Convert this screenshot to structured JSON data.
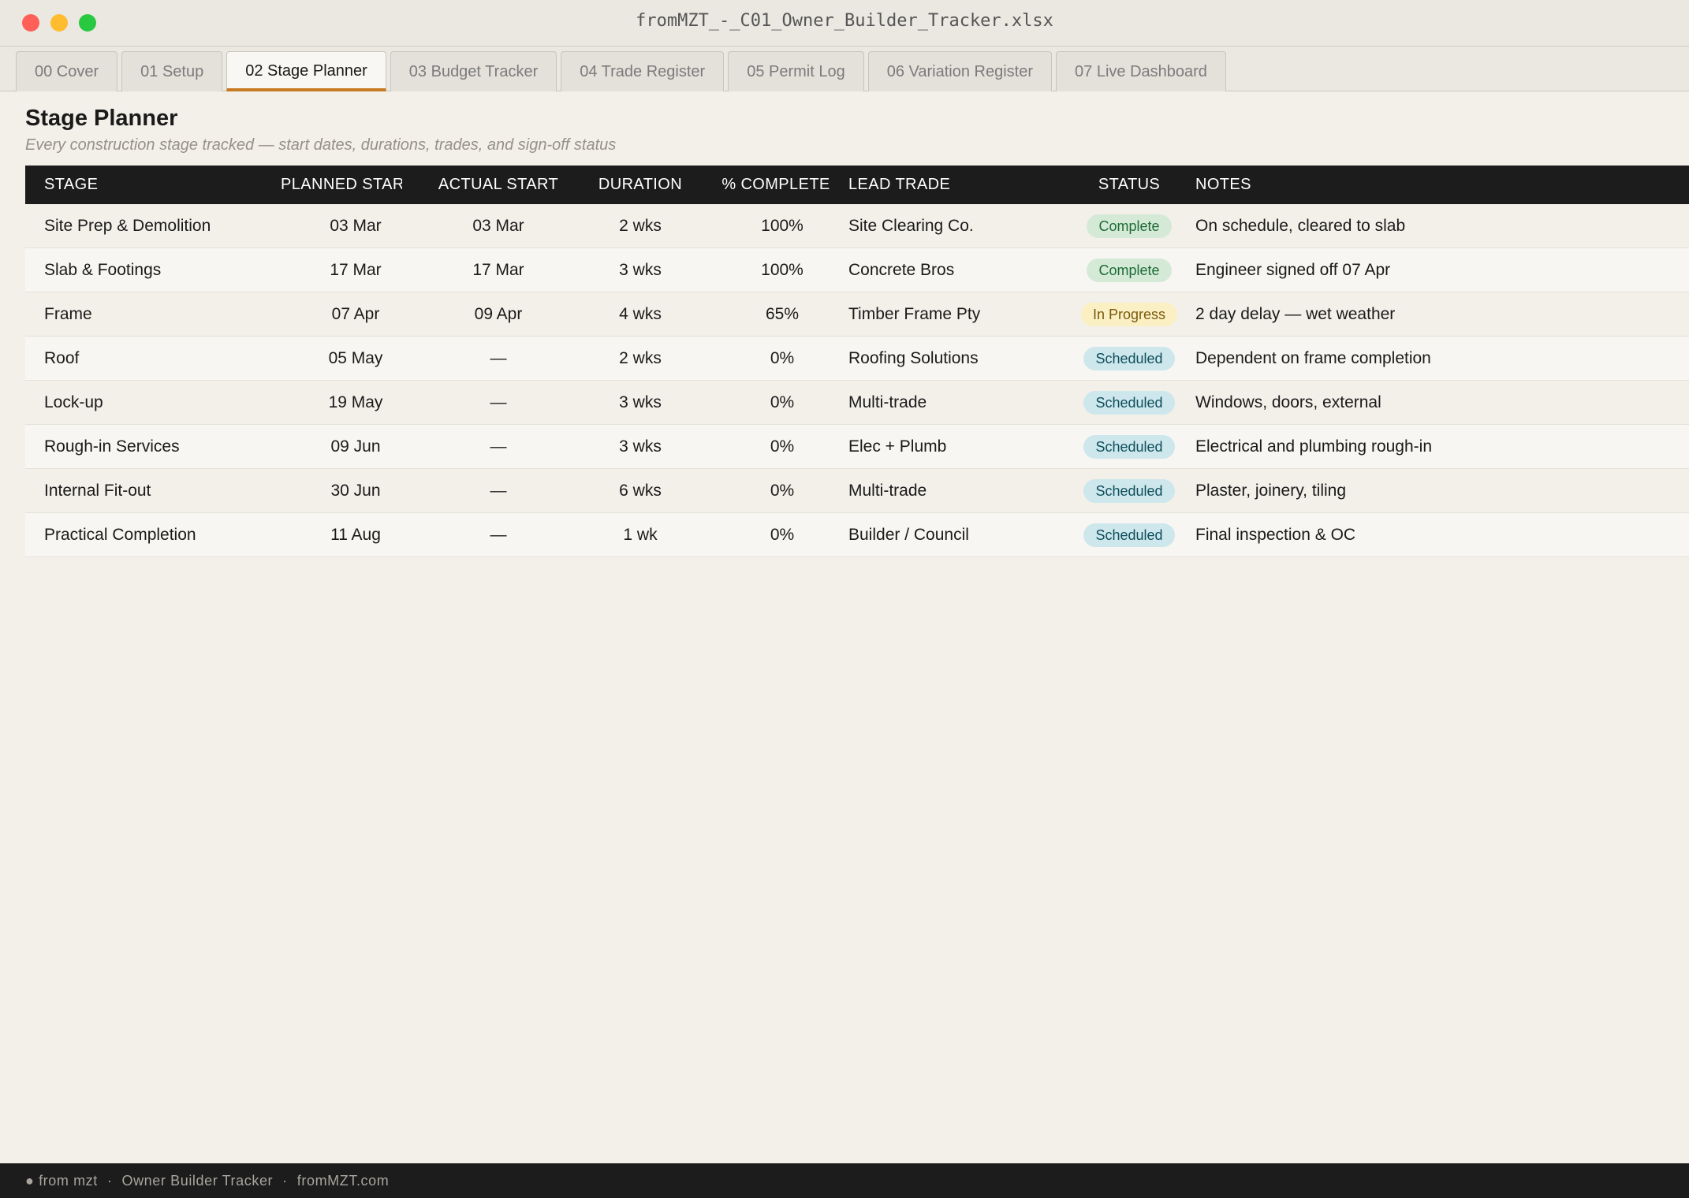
{
  "window": {
    "title": "fromMZT_-_C01_Owner_Builder_Tracker.xlsx"
  },
  "tabs": [
    {
      "label": "00 Cover",
      "active": false
    },
    {
      "label": "01 Setup",
      "active": false
    },
    {
      "label": "02 Stage Planner",
      "active": true
    },
    {
      "label": "03 Budget Tracker",
      "active": false
    },
    {
      "label": "04 Trade Register",
      "active": false
    },
    {
      "label": "05 Permit Log",
      "active": false
    },
    {
      "label": "06 Variation Register",
      "active": false
    },
    {
      "label": "07 Live Dashboard",
      "active": false
    }
  ],
  "page": {
    "title": "Stage Planner",
    "subtitle": "Every construction stage tracked — start dates, durations, trades, and sign-off status"
  },
  "table": {
    "headers": {
      "stage": "STAGE",
      "planned_start": "PLANNED START",
      "actual_start": "ACTUAL START",
      "duration": "DURATION",
      "pct_complete": "% COMPLETE",
      "lead_trade": "LEAD TRADE",
      "status": "STATUS",
      "notes": "NOTES"
    },
    "rows": [
      {
        "stage": "Site Prep & Demolition",
        "planned_start": "03 Mar",
        "actual_start": "03 Mar",
        "duration": "2 wks",
        "pct_complete": "100%",
        "lead_trade": "Site Clearing Co.",
        "status": "Complete",
        "status_kind": "complete",
        "notes": "On schedule, cleared to slab"
      },
      {
        "stage": "Slab & Footings",
        "planned_start": "17 Mar",
        "actual_start": "17 Mar",
        "duration": "3 wks",
        "pct_complete": "100%",
        "lead_trade": "Concrete Bros",
        "status": "Complete",
        "status_kind": "complete",
        "notes": "Engineer signed off 07 Apr"
      },
      {
        "stage": "Frame",
        "planned_start": "07 Apr",
        "actual_start": "09 Apr",
        "duration": "4 wks",
        "pct_complete": "65%",
        "lead_trade": "Timber Frame Pty",
        "status": "In Progress",
        "status_kind": "progress",
        "notes": "2 day delay — wet weather"
      },
      {
        "stage": "Roof",
        "planned_start": "05 May",
        "actual_start": "—",
        "duration": "2 wks",
        "pct_complete": "0%",
        "lead_trade": "Roofing Solutions",
        "status": "Scheduled",
        "status_kind": "scheduled",
        "notes": "Dependent on frame completion"
      },
      {
        "stage": "Lock-up",
        "planned_start": "19 May",
        "actual_start": "—",
        "duration": "3 wks",
        "pct_complete": "0%",
        "lead_trade": "Multi-trade",
        "status": "Scheduled",
        "status_kind": "scheduled",
        "notes": "Windows, doors, external"
      },
      {
        "stage": "Rough-in Services",
        "planned_start": "09 Jun",
        "actual_start": "—",
        "duration": "3 wks",
        "pct_complete": "0%",
        "lead_trade": "Elec + Plumb",
        "status": "Scheduled",
        "status_kind": "scheduled",
        "notes": "Electrical and plumbing rough-in"
      },
      {
        "stage": "Internal Fit-out",
        "planned_start": "30 Jun",
        "actual_start": "—",
        "duration": "6 wks",
        "pct_complete": "0%",
        "lead_trade": "Multi-trade",
        "status": "Scheduled",
        "status_kind": "scheduled",
        "notes": "Plaster, joinery, tiling"
      },
      {
        "stage": "Practical Completion",
        "planned_start": "11 Aug",
        "actual_start": "—",
        "duration": "1 wk",
        "pct_complete": "0%",
        "lead_trade": "Builder / Council",
        "status": "Scheduled",
        "status_kind": "scheduled",
        "notes": "Final inspection & OC"
      }
    ]
  },
  "footer": {
    "brand": "● from mzt",
    "separator": "·",
    "product": "Owner Builder Tracker",
    "site": "fromMZT.com"
  },
  "colors": {
    "accent": "#c77a22",
    "header_bg": "#1c1c1c",
    "complete": "#d4ead7",
    "in_progress": "#fbefc4",
    "scheduled": "#cde7ec"
  }
}
